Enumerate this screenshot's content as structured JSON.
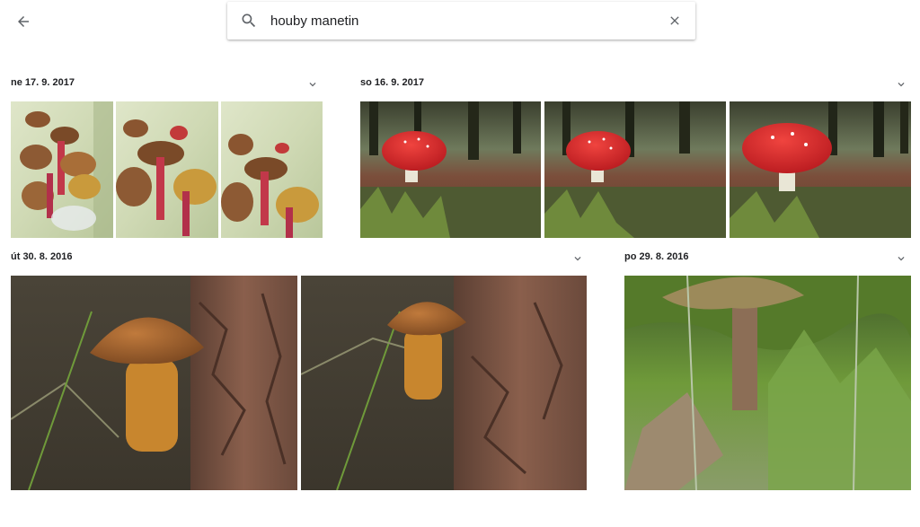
{
  "header": {
    "back_icon": "arrow-back-icon",
    "search": {
      "icon": "search-icon",
      "value": "houby manetin",
      "clear_icon": "close-icon"
    }
  },
  "groups": [
    {
      "date": "ne 17. 9. 2017",
      "photo_count": 3,
      "photo_subject": "boletes-in-bag",
      "chevron_icon": "chevron-down-icon"
    },
    {
      "date": "so 16. 9. 2017",
      "photo_count": 3,
      "photo_subject": "fly-agaric-forest",
      "chevron_icon": "chevron-down-icon"
    },
    {
      "date": "út 30. 8. 2016",
      "photo_count": 2,
      "photo_subject": "bolete-by-tree",
      "chevron_icon": "chevron-down-icon"
    },
    {
      "date": "po 29. 8. 2016",
      "photo_count": 1,
      "photo_subject": "mushroom-in-moss",
      "chevron_icon": "chevron-down-icon"
    }
  ],
  "colors": {
    "mushroom_cap_red": "#d8252a",
    "bolete_cap_brown": "#9a5a2a",
    "moss_green": "#6f9a3a",
    "text": "#202124",
    "icon_gray": "#5f6368"
  }
}
